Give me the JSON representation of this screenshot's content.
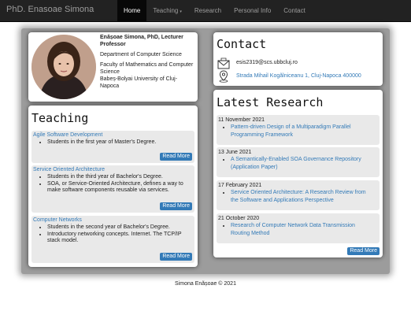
{
  "navbar": {
    "brand": "PhD. Enasoae Simona",
    "items": [
      {
        "label": "Home"
      },
      {
        "label": "Teaching"
      },
      {
        "label": "Research"
      },
      {
        "label": "Personal Info"
      },
      {
        "label": "Contact"
      }
    ],
    "teaching_caret": "▾"
  },
  "profile": {
    "name": "Enășoae Simona, PhD, Lecturer Professor",
    "department": "Department of Computer Science",
    "faculty": "Faculty of Mathematics and Computer Science",
    "university": "Babeș-Bolyai University of Cluj-Napoca"
  },
  "teaching": {
    "title": "Teaching",
    "items": [
      {
        "course": "Agile Software Development",
        "bullets": [
          "Students in the first year of Master's Degree."
        ],
        "button": "Read More"
      },
      {
        "course": "Service Oriented Architecture",
        "bullets": [
          "Students in the third year of Bachelor's Degree.",
          "SOA, or Service-Oriented Architecture, defines a way to make software components reusable via services."
        ],
        "button": "Read More"
      },
      {
        "course": "Computer Networks",
        "bullets": [
          "Students in the second year of Bachelor's Degree.",
          "Introductory networking concepts. Internet. The TCP/IP stack model."
        ],
        "button": "Read More"
      }
    ]
  },
  "contact": {
    "title": "Contact",
    "email": "esis2319@scs.ubbcluj.ro",
    "address": "Strada Mihail Kogălniceanu 1, Cluj-Napoca 400000",
    "email_icon": "envelope-icon",
    "address_icon": "map-pin-icon"
  },
  "research": {
    "title": "Latest Research",
    "items": [
      {
        "date": "11 November 2021",
        "title": "Pattern-driven Design of a Multiparadigm Parallel Programming Framework"
      },
      {
        "date": "13 June 2021",
        "title": "A Semantically-Enabled SOA Governance Repository (Application Paper)"
      },
      {
        "date": "17 February 2021",
        "title": "Service Oriented Architecture: A Research Review from the Software and Applications Perspective"
      },
      {
        "date": "21 October 2020",
        "title": "Research of Computer Network Data Transmission Routing Method"
      }
    ],
    "button": "Read More"
  },
  "footer": "Simona Enășoae © 2021",
  "colors": {
    "link": "#337ab7",
    "navbar": "#222222",
    "panel": "#9c9c9c"
  }
}
